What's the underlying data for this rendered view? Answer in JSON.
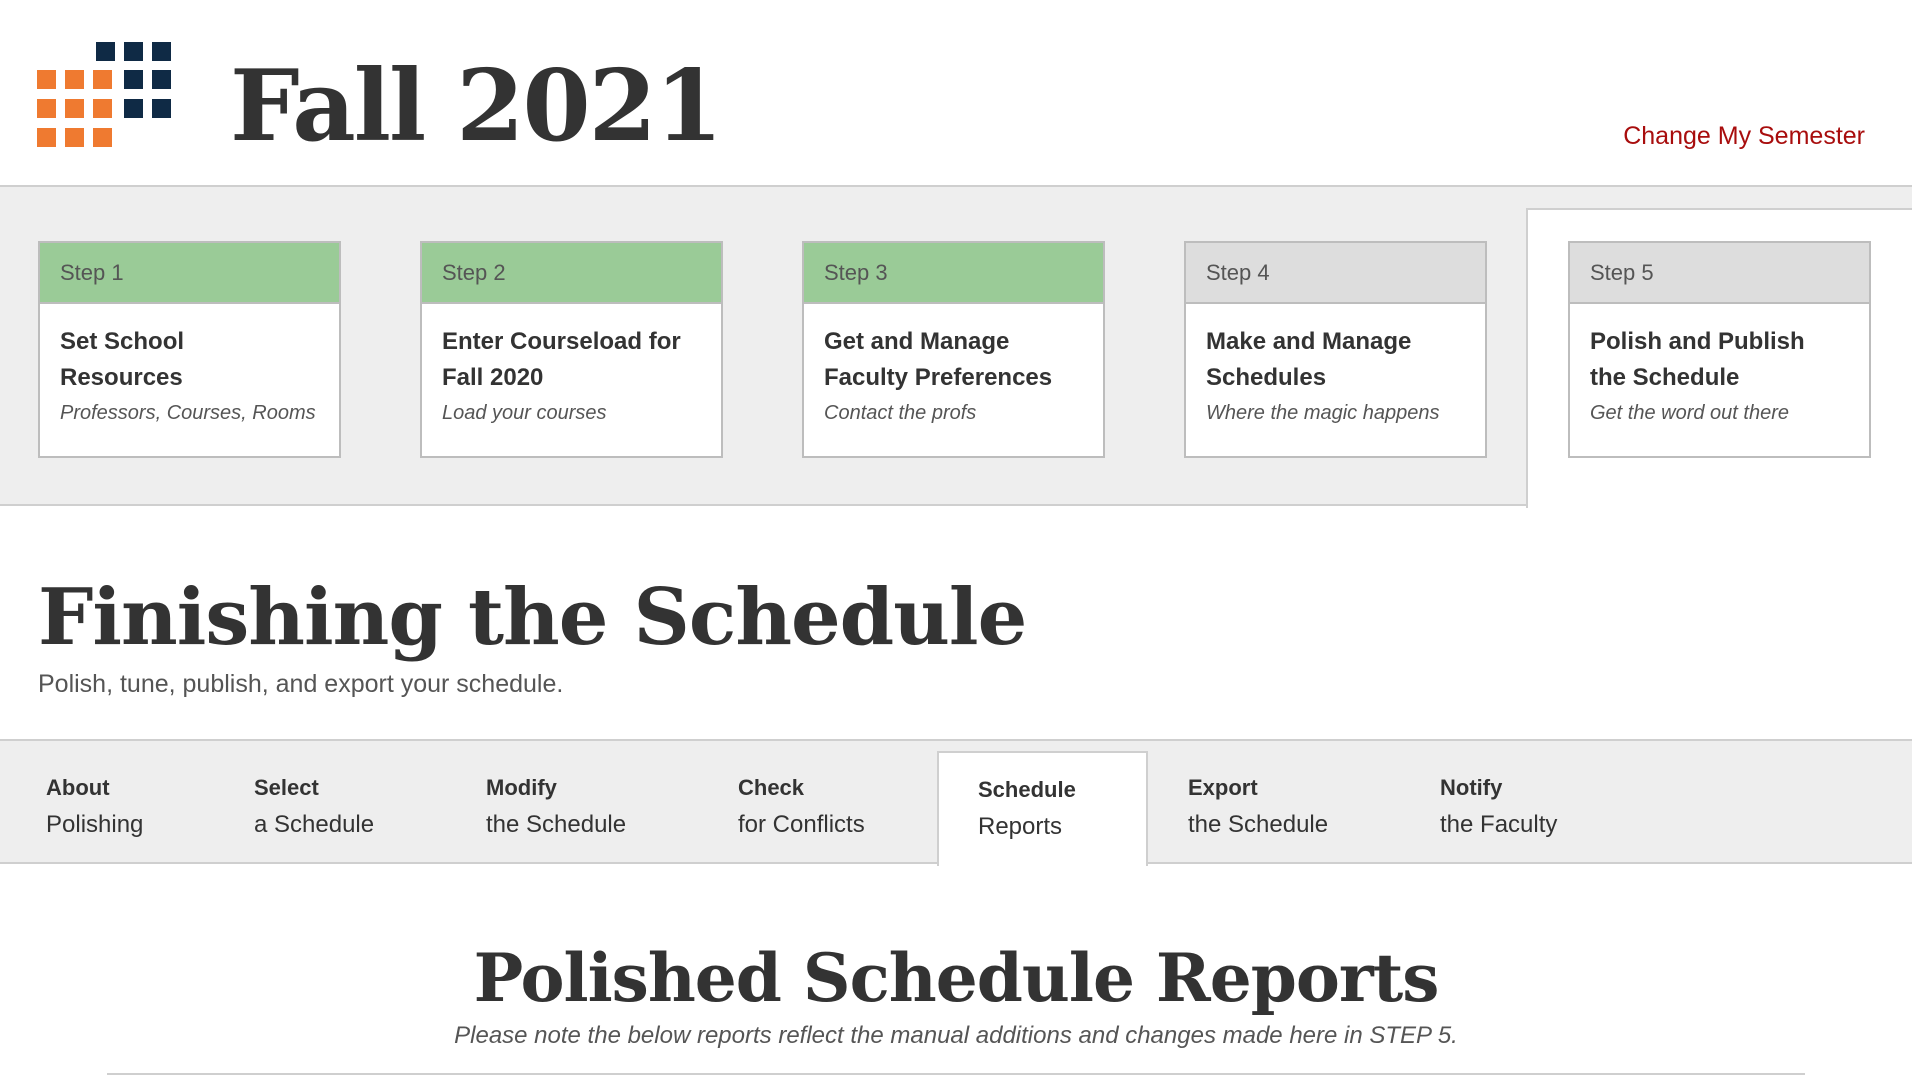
{
  "header": {
    "semester_title": "Fall 2021",
    "change_semester_link": "Change My Semester"
  },
  "colors": {
    "logo_orange": "#ef7a30",
    "logo_navy": "#0f2a45",
    "step_done": "#9acb97",
    "step_todo": "#dddddd",
    "link_red": "#a80d0d"
  },
  "steps": [
    {
      "label": "Step 1",
      "title": "Set School Resources",
      "subtitle": "Professors, Courses, Rooms",
      "status": "done"
    },
    {
      "label": "Step 2",
      "title": "Enter Courseload for Fall 2020",
      "subtitle": "Load your courses",
      "status": "done"
    },
    {
      "label": "Step 3",
      "title": "Get and Manage Faculty Preferences",
      "subtitle": "Contact the profs",
      "status": "done"
    },
    {
      "label": "Step 4",
      "title": "Make and Manage Schedules",
      "subtitle": "Where the magic happens",
      "status": "todo"
    },
    {
      "label": "Step 5",
      "title": "Polish and Publish the Schedule",
      "subtitle": "Get the word out there",
      "status": "current"
    }
  ],
  "section": {
    "title": "Finishing the Schedule",
    "subtitle": "Polish, tune, publish, and export your schedule."
  },
  "tabs": [
    {
      "line1": "About",
      "line2": "Polishing"
    },
    {
      "line1": "Select",
      "line2": "a Schedule"
    },
    {
      "line1": "Modify",
      "line2": "the Schedule"
    },
    {
      "line1": "Check",
      "line2": "for Conflicts"
    },
    {
      "line1": "Schedule",
      "line2": "Reports",
      "active": true
    },
    {
      "line1": "Export",
      "line2": "the Schedule"
    },
    {
      "line1": "Notify",
      "line2": "the Faculty"
    }
  ],
  "reports": {
    "title": "Polished Schedule Reports",
    "note": "Please note the below reports reflect the manual additions and changes made here in STEP 5."
  }
}
